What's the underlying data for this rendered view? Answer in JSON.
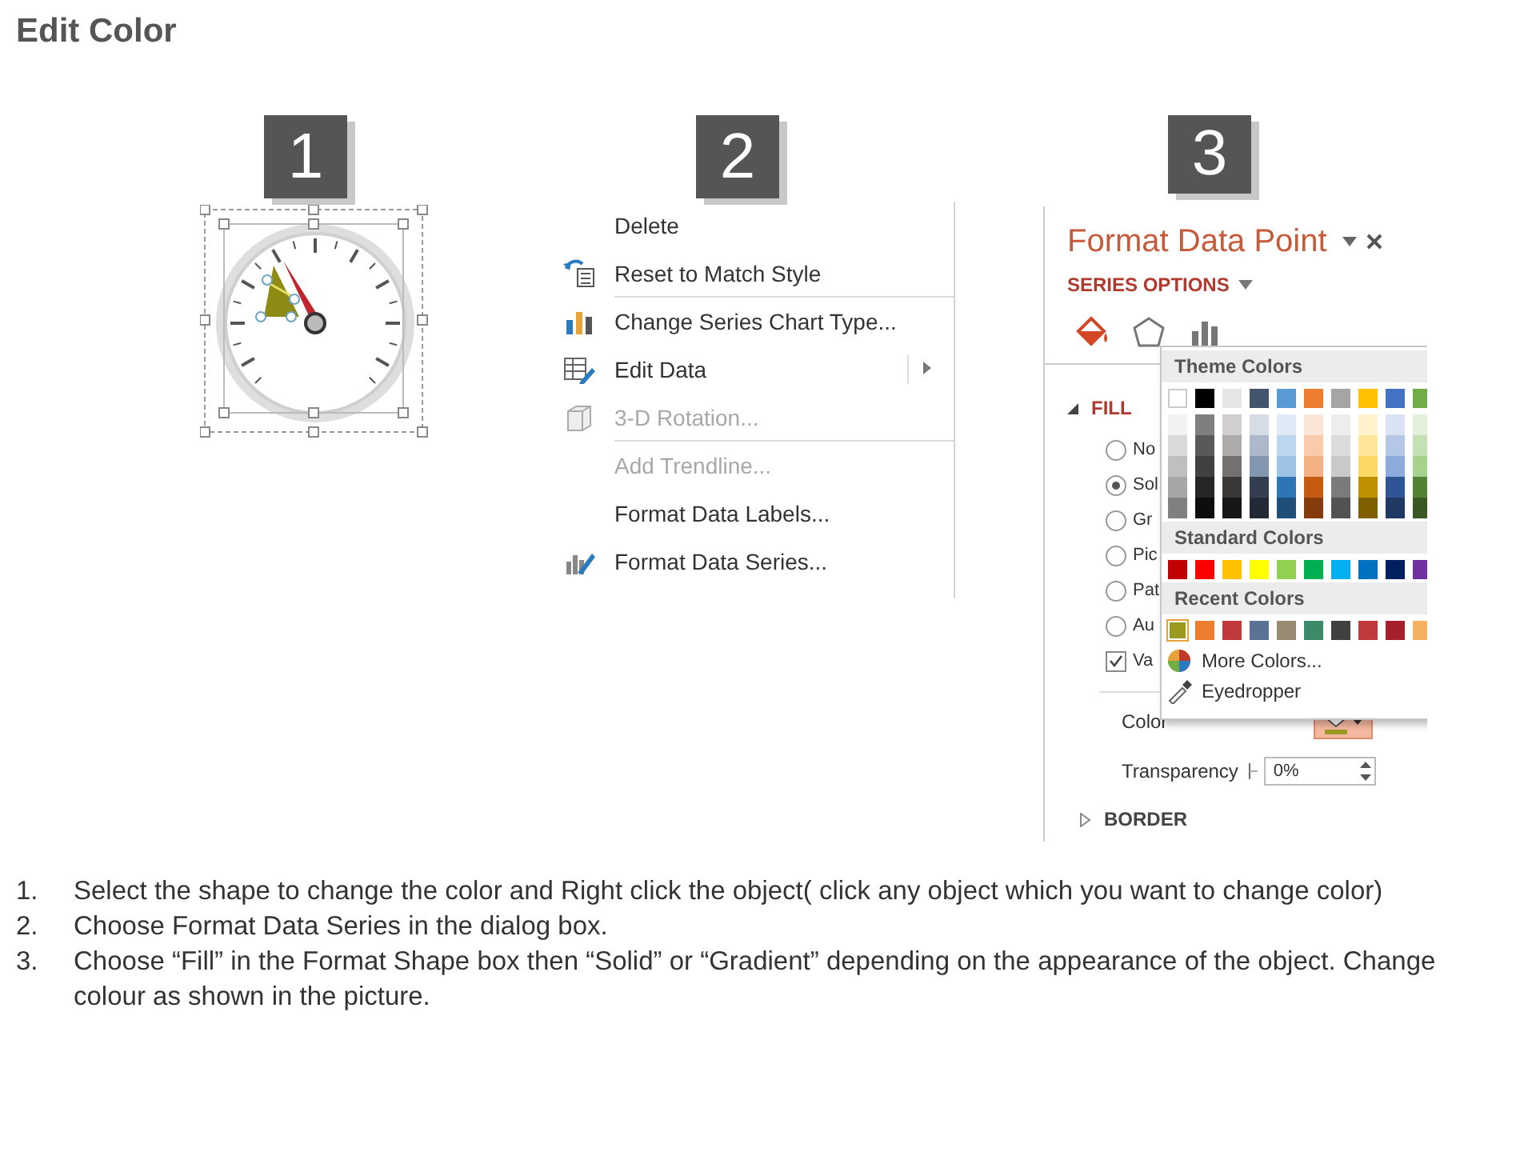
{
  "title": "Edit Color",
  "steps": [
    {
      "number": "1"
    },
    {
      "number": "2"
    },
    {
      "number": "3"
    }
  ],
  "context_menu": {
    "items": [
      {
        "label": "Delete",
        "disabled": false,
        "separator_after": false,
        "submenu": false
      },
      {
        "label": "Reset to Match Style",
        "disabled": false,
        "separator_after": true,
        "submenu": false
      },
      {
        "label": "Change Series Chart Type...",
        "disabled": false,
        "separator_after": false,
        "submenu": false
      },
      {
        "label": "Edit Data",
        "disabled": false,
        "separator_after": false,
        "submenu": true
      },
      {
        "label": "3-D Rotation...",
        "disabled": true,
        "separator_after": true,
        "submenu": false
      },
      {
        "label": "Add Trendline...",
        "disabled": true,
        "separator_after": false,
        "submenu": false
      },
      {
        "label": "Format Data Labels...",
        "disabled": false,
        "separator_after": false,
        "submenu": false
      },
      {
        "label": "Format Data Series...",
        "disabled": false,
        "separator_after": false,
        "submenu": false
      }
    ]
  },
  "format_pane": {
    "title": "Format Data Point",
    "section": "SERIES OPTIONS",
    "tabs": [
      {
        "selected": true
      },
      {
        "selected": false
      },
      {
        "selected": false
      }
    ],
    "fill": {
      "header": "FILL",
      "expanded": true,
      "options": [
        {
          "label": "No",
          "selected": false
        },
        {
          "label": "Sol",
          "selected": true
        },
        {
          "label": "Gr",
          "selected": false
        },
        {
          "label": "Pic",
          "selected": false
        },
        {
          "label": "Pat",
          "selected": false
        },
        {
          "label": "Au",
          "selected": false
        }
      ],
      "vary": {
        "label": "Va",
        "checked": true
      }
    },
    "color": {
      "label": "Color",
      "color": "#9a9a20",
      "open": true
    },
    "transparency": {
      "label": "Transparency",
      "value": "0%"
    },
    "border": {
      "header": "BORDER",
      "expanded": false
    }
  },
  "color_popup": {
    "sections": [
      {
        "heading": "Theme Colors",
        "kind": "theme",
        "swatches": [
          {
            "color": "#ffffff",
            "selected": false,
            "shades": [
              {
                "color": "#f2f2f2",
                "selected": false
              },
              {
                "color": "#d9d9d9",
                "selected": false
              },
              {
                "color": "#bfbfbf",
                "selected": false
              },
              {
                "color": "#a6a6a6",
                "selected": false
              },
              {
                "color": "#808080",
                "selected": false
              }
            ]
          },
          {
            "color": "#000000",
            "selected": false,
            "shades": [
              {
                "color": "#7f7f7f",
                "selected": false
              },
              {
                "color": "#595959",
                "selected": false
              },
              {
                "color": "#404040",
                "selected": false
              },
              {
                "color": "#262626",
                "selected": false
              },
              {
                "color": "#0d0d0d",
                "selected": false
              }
            ]
          },
          {
            "color": "#e7e6e6",
            "selected": false,
            "shades": [
              {
                "color": "#d0cece",
                "selected": false
              },
              {
                "color": "#aeabab",
                "selected": false
              },
              {
                "color": "#757171",
                "selected": false
              },
              {
                "color": "#3b3838",
                "selected": false
              },
              {
                "color": "#171616",
                "selected": false
              }
            ]
          },
          {
            "color": "#44546a",
            "selected": false,
            "shades": [
              {
                "color": "#d6dce5",
                "selected": false
              },
              {
                "color": "#adb9ca",
                "selected": false
              },
              {
                "color": "#8497b0",
                "selected": false
              },
              {
                "color": "#333f50",
                "selected": false
              },
              {
                "color": "#222a35",
                "selected": false
              }
            ]
          },
          {
            "color": "#5b9bd5",
            "selected": false,
            "shades": [
              {
                "color": "#deebf7",
                "selected": false
              },
              {
                "color": "#bdd7ee",
                "selected": false
              },
              {
                "color": "#9dc3e6",
                "selected": false
              },
              {
                "color": "#2e75b6",
                "selected": false
              },
              {
                "color": "#1f4e79",
                "selected": false
              }
            ]
          },
          {
            "color": "#ed7d31",
            "selected": false,
            "shades": [
              {
                "color": "#fbe5d6",
                "selected": false
              },
              {
                "color": "#f8cbad",
                "selected": false
              },
              {
                "color": "#f4b183",
                "selected": false
              },
              {
                "color": "#c55a11",
                "selected": false
              },
              {
                "color": "#843c0c",
                "selected": false
              }
            ]
          },
          {
            "color": "#a5a5a5",
            "selected": false,
            "shades": [
              {
                "color": "#ededed",
                "selected": false
              },
              {
                "color": "#dbdbdb",
                "selected": false
              },
              {
                "color": "#c9c9c9",
                "selected": false
              },
              {
                "color": "#7b7b7b",
                "selected": false
              },
              {
                "color": "#525252",
                "selected": false
              }
            ]
          },
          {
            "color": "#ffc000",
            "selected": false,
            "shades": [
              {
                "color": "#fff2cc",
                "selected": false
              },
              {
                "color": "#ffe699",
                "selected": false
              },
              {
                "color": "#ffd966",
                "selected": false
              },
              {
                "color": "#bf9000",
                "selected": false
              },
              {
                "color": "#7f6000",
                "selected": false
              }
            ]
          },
          {
            "color": "#4472c4",
            "selected": false,
            "shades": [
              {
                "color": "#dae3f3",
                "selected": false
              },
              {
                "color": "#b4c7e7",
                "selected": false
              },
              {
                "color": "#8faadc",
                "selected": false
              },
              {
                "color": "#2f5597",
                "selected": false
              },
              {
                "color": "#203864",
                "selected": false
              }
            ]
          },
          {
            "color": "#70ad47",
            "selected": false,
            "shades": [
              {
                "color": "#e2f0d9",
                "selected": false
              },
              {
                "color": "#c5e0b4",
                "selected": false
              },
              {
                "color": "#a9d18e",
                "selected": false
              },
              {
                "color": "#548235",
                "selected": false
              },
              {
                "color": "#385723",
                "selected": false
              }
            ]
          }
        ]
      },
      {
        "heading": "Standard Colors",
        "kind": "plain",
        "swatches": [
          {
            "color": "#c00000",
            "selected": false
          },
          {
            "color": "#ff0000",
            "selected": false
          },
          {
            "color": "#ffc000",
            "selected": false
          },
          {
            "color": "#ffff00",
            "selected": false
          },
          {
            "color": "#92d050",
            "selected": false
          },
          {
            "color": "#00b050",
            "selected": false
          },
          {
            "color": "#00b0f0",
            "selected": false
          },
          {
            "color": "#0070c0",
            "selected": false
          },
          {
            "color": "#002060",
            "selected": false
          },
          {
            "color": "#7030a0",
            "selected": false
          }
        ]
      },
      {
        "heading": "Recent Colors",
        "kind": "plain",
        "swatches": [
          {
            "color": "#9a9a20",
            "selected": true
          },
          {
            "color": "#ed7d31",
            "selected": false
          },
          {
            "color": "#c0393b",
            "selected": false
          },
          {
            "color": "#5a7394",
            "selected": false
          },
          {
            "color": "#978b73",
            "selected": false
          },
          {
            "color": "#3c8a6a",
            "selected": false
          },
          {
            "color": "#404040",
            "selected": false
          },
          {
            "color": "#c0393b",
            "selected": false
          },
          {
            "color": "#a5202a",
            "selected": false
          },
          {
            "color": "#f5b060",
            "selected": false
          }
        ]
      }
    ],
    "actions": [
      {
        "label": "More Colors..."
      },
      {
        "label": "Eyedropper"
      }
    ]
  },
  "instructions": [
    {
      "number": "1.",
      "text": "Select the shape to change the color and Right click the object( click any object which you want to change color)"
    },
    {
      "number": "2.",
      "text": "Choose Format Data Series in the dialog box."
    },
    {
      "number": "3.",
      "text": "Choose “Fill” in the Format Shape box then  “Solid” or “Gradient” depending on the appearance of the object. Change colour as shown in the picture."
    }
  ]
}
